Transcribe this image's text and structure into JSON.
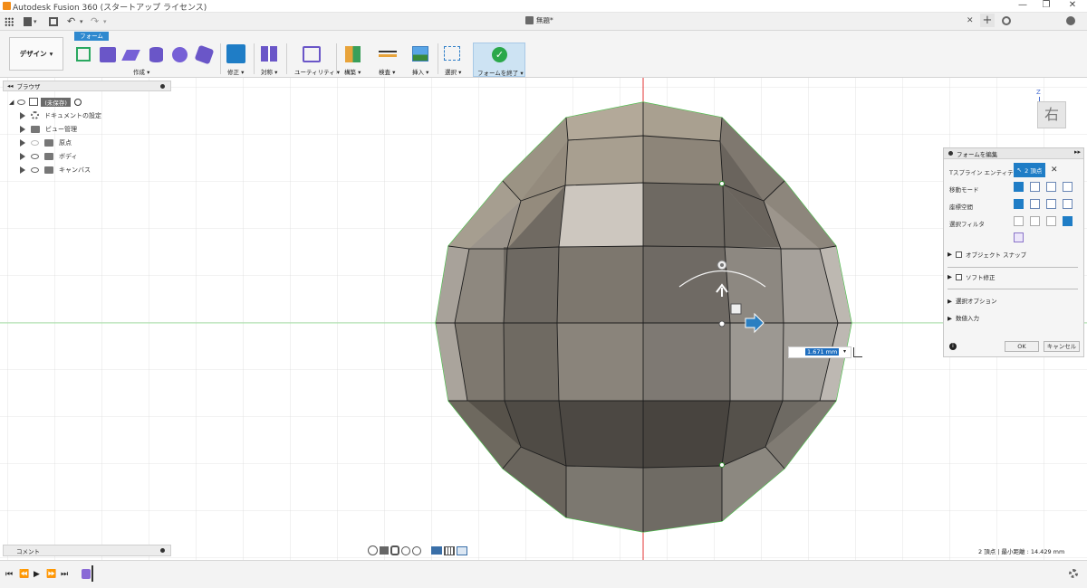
{
  "window": {
    "title": "Autodesk Fusion 360 (スタートアップ ライセンス)",
    "min": "—",
    "restore": "❐",
    "close": "✕"
  },
  "tabs": {
    "doc_title": "無題*",
    "close": "✕",
    "add": "+"
  },
  "toolbar": {
    "workspace": "デザイン",
    "active_tab": "フォーム",
    "groups": [
      {
        "label": "作成"
      },
      {
        "label": "修正"
      },
      {
        "label": "対称"
      },
      {
        "label": "ユーティリティ"
      },
      {
        "label": "構築"
      },
      {
        "label": "検査"
      },
      {
        "label": "挿入"
      },
      {
        "label": "選択"
      },
      {
        "label": "フォームを終了"
      }
    ]
  },
  "browser": {
    "title": "ブラウザ",
    "root": "(未保存)",
    "items": [
      {
        "label": "ドキュメントの設定"
      },
      {
        "label": "ビュー管理"
      },
      {
        "label": "原点"
      },
      {
        "label": "ボディ"
      },
      {
        "label": "キャンバス"
      }
    ]
  },
  "viewcube": {
    "face": "右",
    "axis": "Z"
  },
  "manipulator": {
    "input_value": "1.671 mm"
  },
  "edit_form": {
    "title": "フォームを編集",
    "rows": [
      {
        "label": "Tスプライン エンティティ",
        "value": "2 頂点"
      },
      {
        "label": "移動モード"
      },
      {
        "label": "座標空間"
      },
      {
        "label": "選択フィルタ"
      }
    ],
    "sections": [
      {
        "label": "オブジェクト スナップ",
        "checkbox": true
      },
      {
        "label": "ソフト修正",
        "checkbox": true
      },
      {
        "label": "選択オプション"
      },
      {
        "label": "数値入力"
      }
    ],
    "ok": "OK",
    "cancel": "キャンセル"
  },
  "comments": {
    "title": "コメント"
  },
  "status": {
    "text": "2 頂点 | 最小距離 : 14.429 mm"
  },
  "colors": {
    "accent": "#1f7dc6",
    "green_edge": "#44c244",
    "red_axis": "#e02020"
  }
}
